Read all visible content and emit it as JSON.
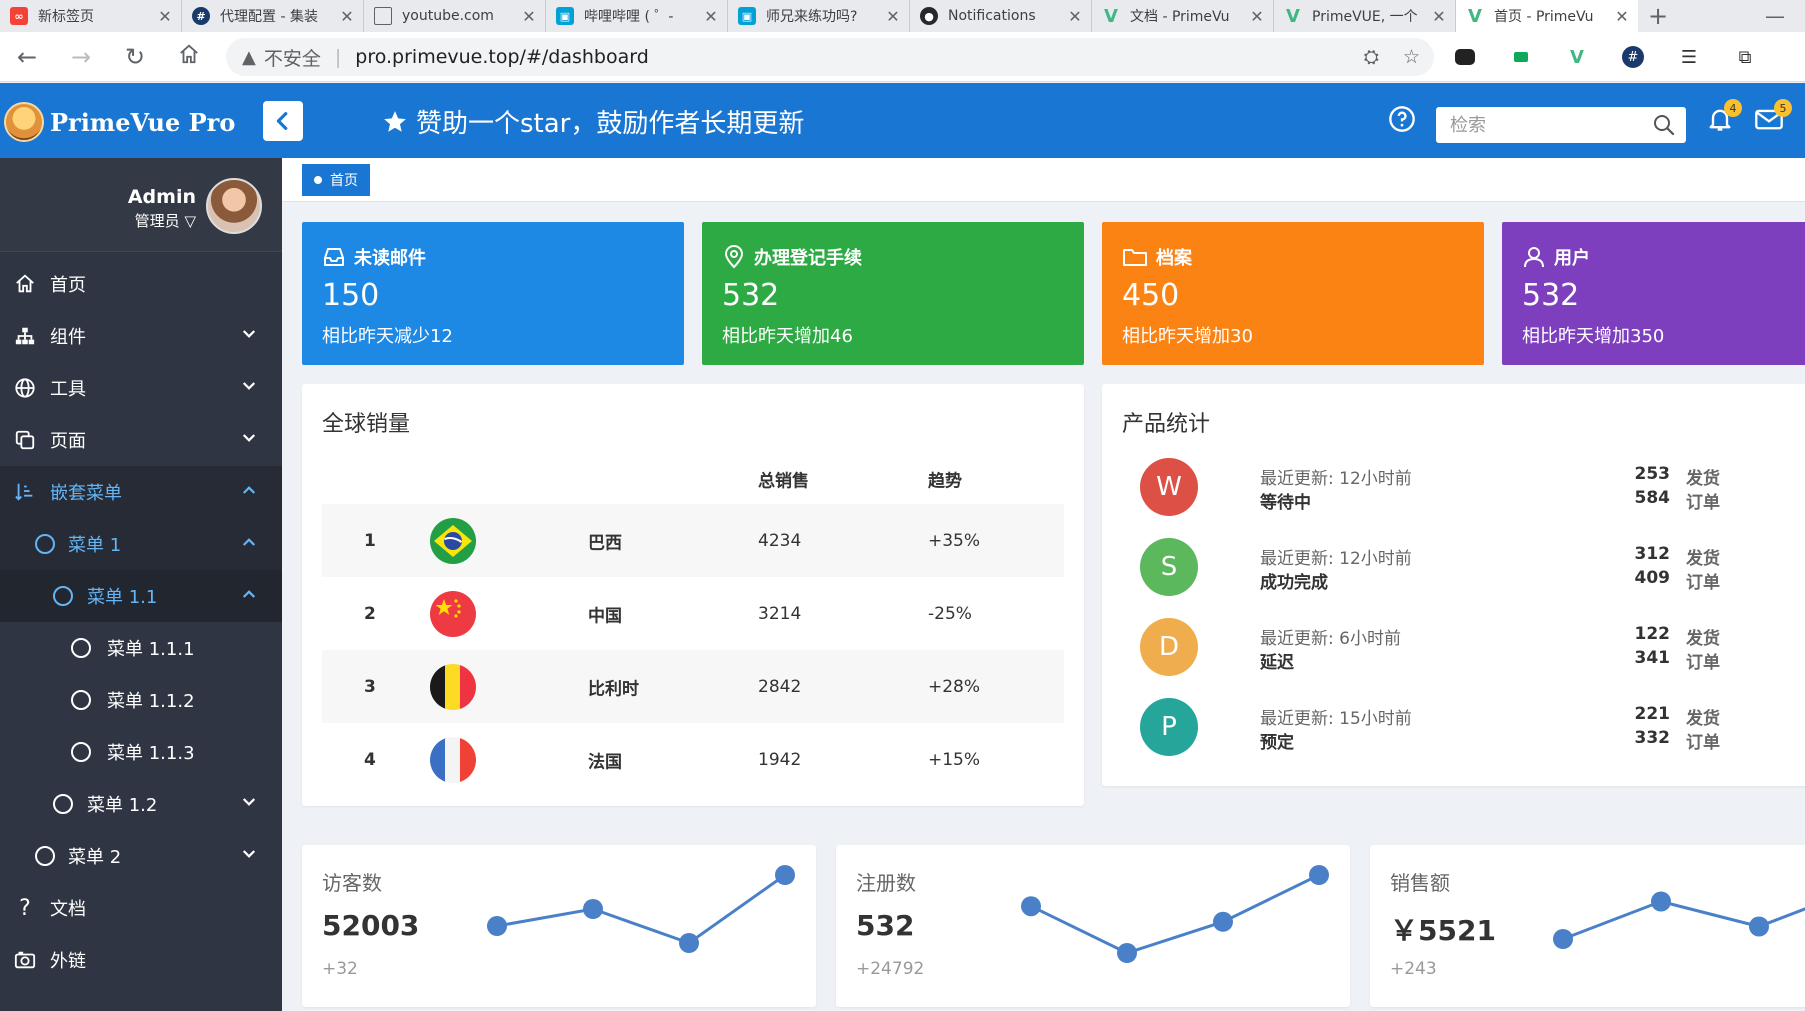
{
  "browser": {
    "tabs": [
      {
        "title": "新标签页",
        "icon": "infinity-icon",
        "color": "#f44336"
      },
      {
        "title": "代理配置 - 集装",
        "icon": "hash-icon",
        "color": "#1a3a6b"
      },
      {
        "title": "youtube.com",
        "icon": "page-icon",
        "color": "#ffffff"
      },
      {
        "title": "哔哩哔哩 ( ゜-",
        "icon": "bilibili-icon",
        "color": "#00a1d6"
      },
      {
        "title": "师兄来练功吗?",
        "icon": "bilibili-icon",
        "color": "#00a1d6"
      },
      {
        "title": "Notifications",
        "icon": "github-icon",
        "color": "#24292e"
      },
      {
        "title": "文档 - PrimeVu",
        "icon": "primevue-icon",
        "color": "#41b883"
      },
      {
        "title": "PrimeVUE, 一个",
        "icon": "primevue-icon",
        "color": "#41b883"
      },
      {
        "title": "首页 - PrimeVu",
        "icon": "primevue-icon",
        "color": "#41b883"
      }
    ],
    "insecure_label": "不安全",
    "url": "pro.primevue.top/#/dashboard"
  },
  "header": {
    "logo_text": "PrimeVue Pro",
    "star_message": "赞助一个star，鼓励作者长期更新",
    "search_placeholder": "检索",
    "notify_badge": "4",
    "mail_badge": "5",
    "color": "#1976d2"
  },
  "sidebar": {
    "user_name": "Admin",
    "user_role": "管理员",
    "items": [
      {
        "label": "首页"
      },
      {
        "label": "组件"
      },
      {
        "label": "工具"
      },
      {
        "label": "页面"
      },
      {
        "label": "嵌套菜单"
      },
      {
        "label": "菜单 1"
      },
      {
        "label": "菜单 1.1"
      },
      {
        "label": "菜单 1.1.1"
      },
      {
        "label": "菜单 1.1.2"
      },
      {
        "label": "菜单 1.1.3"
      },
      {
        "label": "菜单 1.2"
      },
      {
        "label": "菜单 2"
      },
      {
        "label": "文档"
      },
      {
        "label": "外链"
      }
    ]
  },
  "breadcrumb": {
    "label": "首页"
  },
  "stats": [
    {
      "title": "未读邮件",
      "value": "150",
      "sub": "相比昨天减少12",
      "color": "#1e88e5",
      "icon": "inbox-icon"
    },
    {
      "title": "办理登记手续",
      "value": "532",
      "sub": "相比昨天增加46",
      "color": "#2eaa45",
      "icon": "map-marker-icon"
    },
    {
      "title": "档案",
      "value": "450",
      "sub": "相比昨天增加30",
      "color": "#fb8314",
      "icon": "folder-icon"
    },
    {
      "title": "用户",
      "value": "532",
      "sub": "相比昨天增加350",
      "color": "#7e3fbf",
      "icon": "user-icon"
    }
  ],
  "sales": {
    "title": "全球销量",
    "col_total": "总销售",
    "col_trend": "趋势",
    "rows": [
      {
        "rank": "1",
        "country": "巴西",
        "flag": "brazil-flag-icon",
        "total": "4234",
        "trend": "+35%"
      },
      {
        "rank": "2",
        "country": "中国",
        "flag": "china-flag-icon",
        "total": "3214",
        "trend": "-25%"
      },
      {
        "rank": "3",
        "country": "比利时",
        "flag": "belgium-flag-icon",
        "total": "2842",
        "trend": "+28%"
      },
      {
        "rank": "4",
        "country": "法国",
        "flag": "france-flag-icon",
        "total": "1942",
        "trend": "+15%"
      }
    ]
  },
  "products": {
    "title": "产品统计",
    "ship_label": "发货",
    "order_label": "订单",
    "rows": [
      {
        "letter": "W",
        "color": "#dc5045",
        "updated": "最近更新: 12小时前",
        "status": "等待中",
        "ship": "253",
        "orders": "584"
      },
      {
        "letter": "S",
        "color": "#5cb85c",
        "updated": "最近更新: 12小时前",
        "status": "成功完成",
        "ship": "312",
        "orders": "409"
      },
      {
        "letter": "D",
        "color": "#f0ad4e",
        "updated": "最近更新: 6小时前",
        "status": "延迟",
        "ship": "122",
        "orders": "341"
      },
      {
        "letter": "P",
        "color": "#26a69a",
        "updated": "最近更新: 15小时前",
        "status": "预定",
        "ship": "221",
        "orders": "332"
      }
    ]
  },
  "mini_stats": [
    {
      "title": "访客数",
      "value": "52003",
      "sub": "+32"
    },
    {
      "title": "注册数",
      "value": "532",
      "sub": "+24792"
    },
    {
      "title": "销售额",
      "value": "￥5521",
      "sub": "+243"
    }
  ],
  "chart_data": [
    {
      "type": "line",
      "series": [
        {
          "values": [
            3,
            4,
            2,
            6
          ]
        }
      ],
      "color": "#4a80c8"
    },
    {
      "type": "line",
      "series": [
        {
          "values": [
            4,
            1,
            3,
            6
          ]
        }
      ],
      "color": "#4a80c8"
    },
    {
      "type": "line",
      "series": [
        {
          "values": [
            2,
            5,
            3,
            6
          ]
        }
      ],
      "color": "#4a80c8"
    }
  ]
}
